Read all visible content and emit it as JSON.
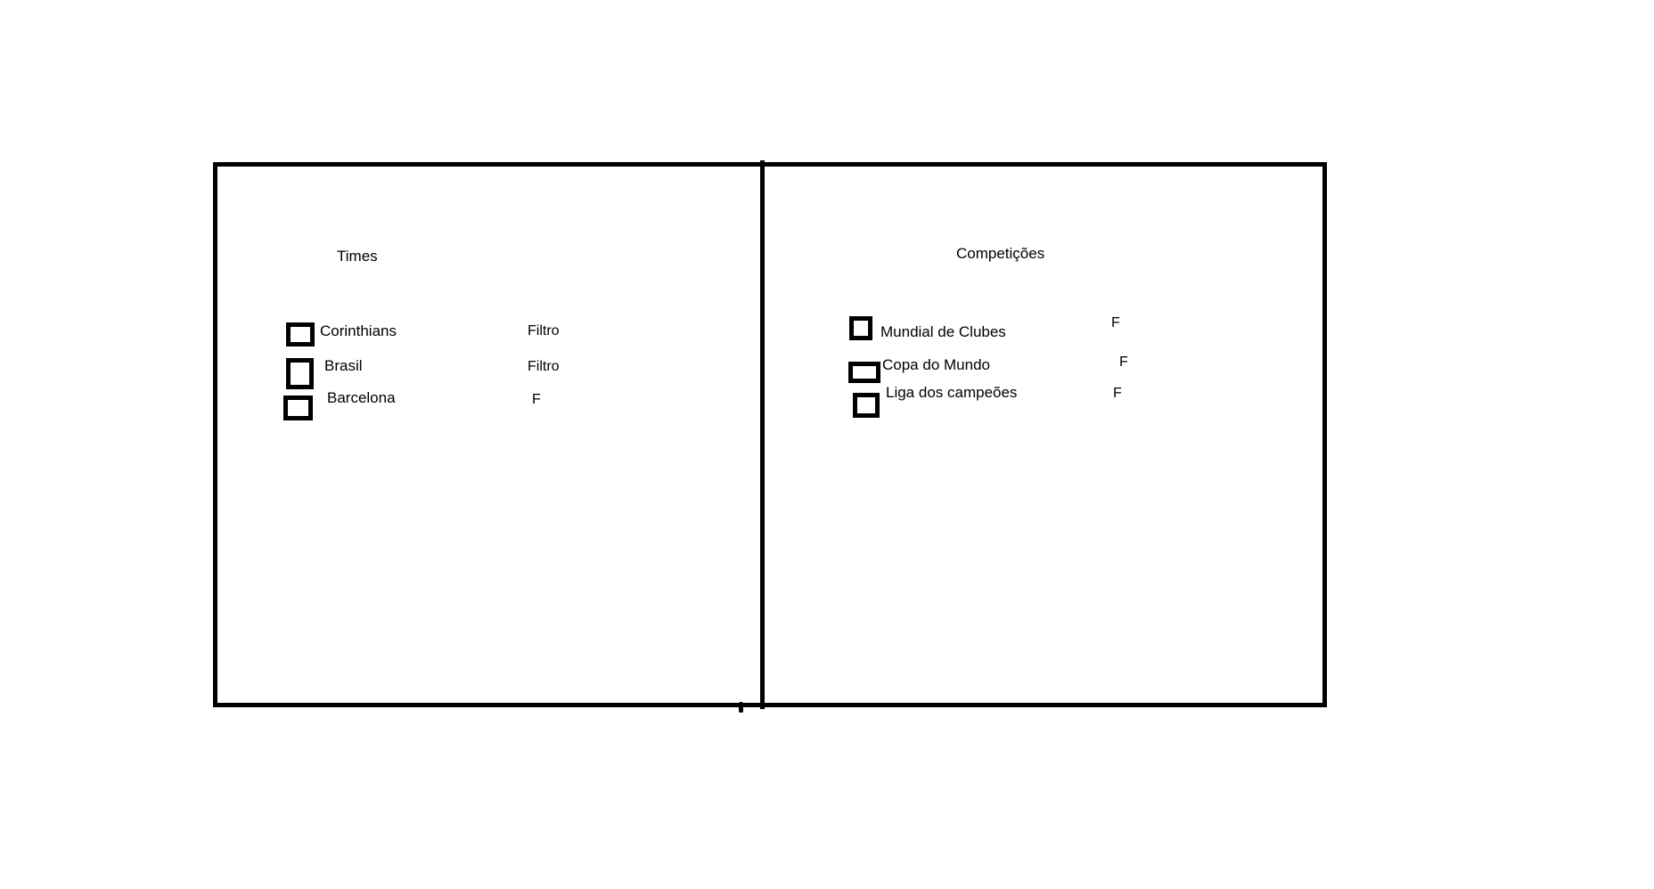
{
  "panels": {
    "teams": {
      "title": "Times",
      "items": [
        {
          "label": "Corinthians",
          "filter": "Filtro",
          "checked": false
        },
        {
          "label": "Brasil",
          "filter": "Filtro",
          "checked": false
        },
        {
          "label": "Barcelona",
          "filter": "F",
          "checked": false
        }
      ]
    },
    "competitions": {
      "title": "Competições",
      "items": [
        {
          "label": "Mundial de Clubes",
          "filter": "F",
          "checked": false
        },
        {
          "label": "Copa do Mundo",
          "filter": "F",
          "checked": false
        },
        {
          "label": "Liga dos campeões",
          "filter": "F",
          "checked": false
        }
      ]
    }
  }
}
